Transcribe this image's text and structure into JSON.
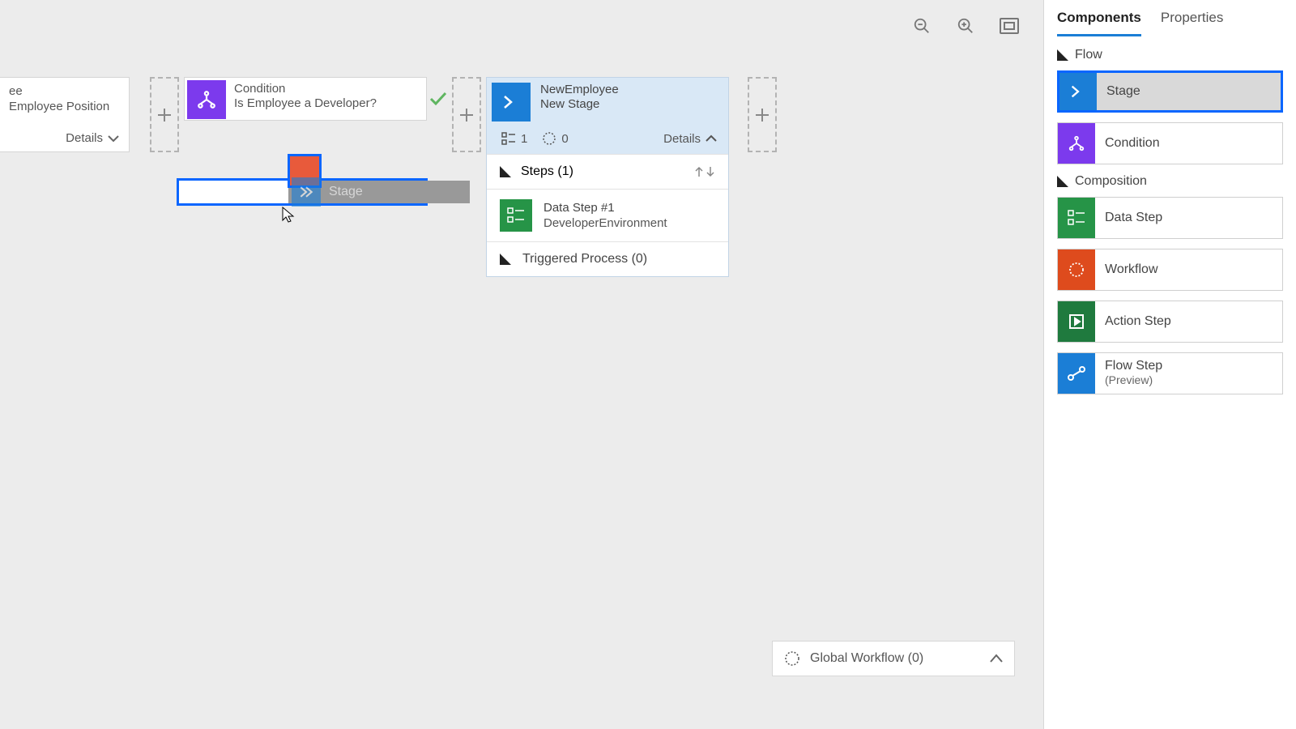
{
  "toolbar": {
    "zoom_out": "zoom-out",
    "zoom_in": "zoom-in",
    "fit": "fit-to-screen"
  },
  "partial_stage": {
    "line1": "ee",
    "line2": "Employee Position",
    "details": "Details"
  },
  "condition_node": {
    "title": "Condition",
    "subtitle": "Is Employee a Developer?"
  },
  "drag_ghost_label": "Stage",
  "new_stage": {
    "title": "NewEmployee",
    "subtitle": "New Stage",
    "count_steps_icon": "1",
    "count_wf_icon": "0",
    "details": "Details",
    "steps_header": "Steps (1)",
    "data_step_title": "Data Step #1",
    "data_step_sub": "DeveloperEnvironment",
    "triggered": "Triggered Process (0)"
  },
  "global_workflow": "Global Workflow (0)",
  "sidebar": {
    "tabs": {
      "components": "Components",
      "properties": "Properties"
    },
    "group_flow": "Flow",
    "group_composition": "Composition",
    "items": {
      "stage": "Stage",
      "condition": "Condition",
      "datastep": "Data Step",
      "workflow": "Workflow",
      "action": "Action Step",
      "flowstep_l1": "Flow Step",
      "flowstep_l2": "(Preview)"
    }
  }
}
